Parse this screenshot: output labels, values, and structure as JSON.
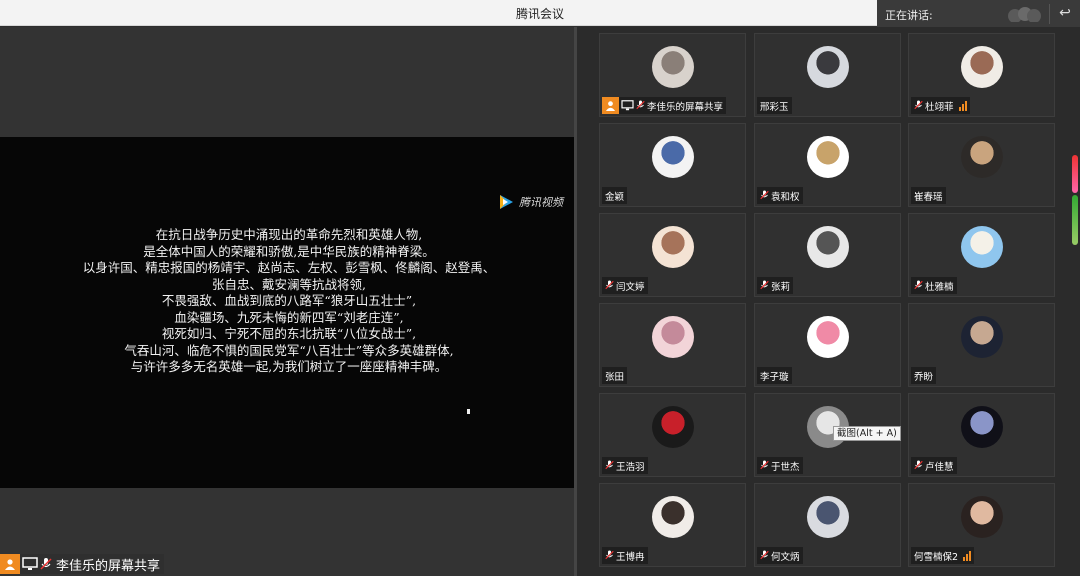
{
  "window": {
    "title": "腾讯会议"
  },
  "speaking": {
    "label": "正在讲话:"
  },
  "share": {
    "logo_text": "腾讯视频",
    "lines": [
      "在抗日战争历史中涌现出的革命先烈和英雄人物,",
      "是全体中国人的荣耀和骄傲,是中华民族的精神脊梁。",
      "以身许国、精忠报国的杨靖宇、赵尚志、左权、彭雪枫、佟麟阁、赵登禹、",
      "张自忠、戴安澜等抗战将领,",
      "不畏强敌、血战到底的八路军“狼牙山五壮士”,",
      "血染疆场、九死未悔的新四军“刘老庄连”,",
      "视死如归、宁死不屈的东北抗联“八位女战士”,",
      "气吞山河、临危不惧的国民党军“八百壮士”等众多英雄群体,",
      "与许许多多无名英雄一起,为我们树立了一座座精神丰碑。"
    ],
    "sharer_label": "李佳乐的屏幕共享"
  },
  "tooltip": "截图(Alt + A)",
  "participants": [
    {
      "name": "李佳乐的屏幕共享",
      "mic": true,
      "host": true,
      "screen": true,
      "signal": false,
      "avatar_colors": [
        "#d8d2cc",
        "#8a7f78"
      ]
    },
    {
      "name": "邢彩玉",
      "mic": false,
      "host": false,
      "screen": false,
      "signal": false,
      "avatar_colors": [
        "#d6d9de",
        "#3a3a3e"
      ]
    },
    {
      "name": "杜翊菲",
      "mic": true,
      "host": false,
      "screen": false,
      "signal": true,
      "avatar_colors": [
        "#f0ece6",
        "#9a6a55"
      ]
    },
    {
      "name": "金颖",
      "mic": false,
      "host": false,
      "screen": false,
      "signal": false,
      "avatar_colors": [
        "#f3f3f3",
        "#4a6aa8"
      ]
    },
    {
      "name": "袁和权",
      "mic": true,
      "host": false,
      "screen": false,
      "signal": false,
      "avatar_colors": [
        "#ffffff",
        "#c8a36a"
      ]
    },
    {
      "name": "崔春瑶",
      "mic": false,
      "host": false,
      "screen": false,
      "signal": false,
      "avatar_colors": [
        "#2d2a28",
        "#c9a47e"
      ]
    },
    {
      "name": "闫文婷",
      "mic": true,
      "host": false,
      "screen": false,
      "signal": false,
      "avatar_colors": [
        "#f4e3d4",
        "#a6735a"
      ]
    },
    {
      "name": "张莉",
      "mic": true,
      "host": false,
      "screen": false,
      "signal": false,
      "avatar_colors": [
        "#e8e8e8",
        "#555555"
      ]
    },
    {
      "name": "杜雅楠",
      "mic": true,
      "host": false,
      "screen": false,
      "signal": false,
      "avatar_colors": [
        "#8fc6ee",
        "#f4f1e8"
      ]
    },
    {
      "name": "张田",
      "mic": false,
      "host": false,
      "screen": false,
      "signal": false,
      "avatar_colors": [
        "#f2d4d8",
        "#c48a9a"
      ]
    },
    {
      "name": "李子璇",
      "mic": false,
      "host": false,
      "screen": false,
      "signal": false,
      "avatar_colors": [
        "#ffffff",
        "#f08aa6"
      ]
    },
    {
      "name": "乔盼",
      "mic": false,
      "host": false,
      "screen": false,
      "signal": false,
      "avatar_colors": [
        "#1d2333",
        "#c6a891"
      ]
    },
    {
      "name": "王浩羽",
      "mic": true,
      "host": false,
      "screen": false,
      "signal": false,
      "avatar_colors": [
        "#1a1a1a",
        "#c8202a"
      ]
    },
    {
      "name": "于世杰",
      "mic": true,
      "host": false,
      "screen": false,
      "signal": false,
      "avatar_colors": [
        "#8a8a8a",
        "#e6e6e6"
      ]
    },
    {
      "name": "卢佳慧",
      "mic": true,
      "host": false,
      "screen": false,
      "signal": false,
      "avatar_colors": [
        "#101018",
        "#8a95c8"
      ]
    },
    {
      "name": "王博冉",
      "mic": true,
      "host": false,
      "screen": false,
      "signal": false,
      "avatar_colors": [
        "#f0ece8",
        "#3a302c"
      ]
    },
    {
      "name": "何文炳",
      "mic": true,
      "host": false,
      "screen": false,
      "signal": false,
      "avatar_colors": [
        "#d9dbe0",
        "#4a5570"
      ]
    },
    {
      "name": "何雪楠保2",
      "mic": false,
      "host": false,
      "screen": false,
      "signal": true,
      "avatar_colors": [
        "#2a2220",
        "#e0b9a0"
      ]
    }
  ]
}
